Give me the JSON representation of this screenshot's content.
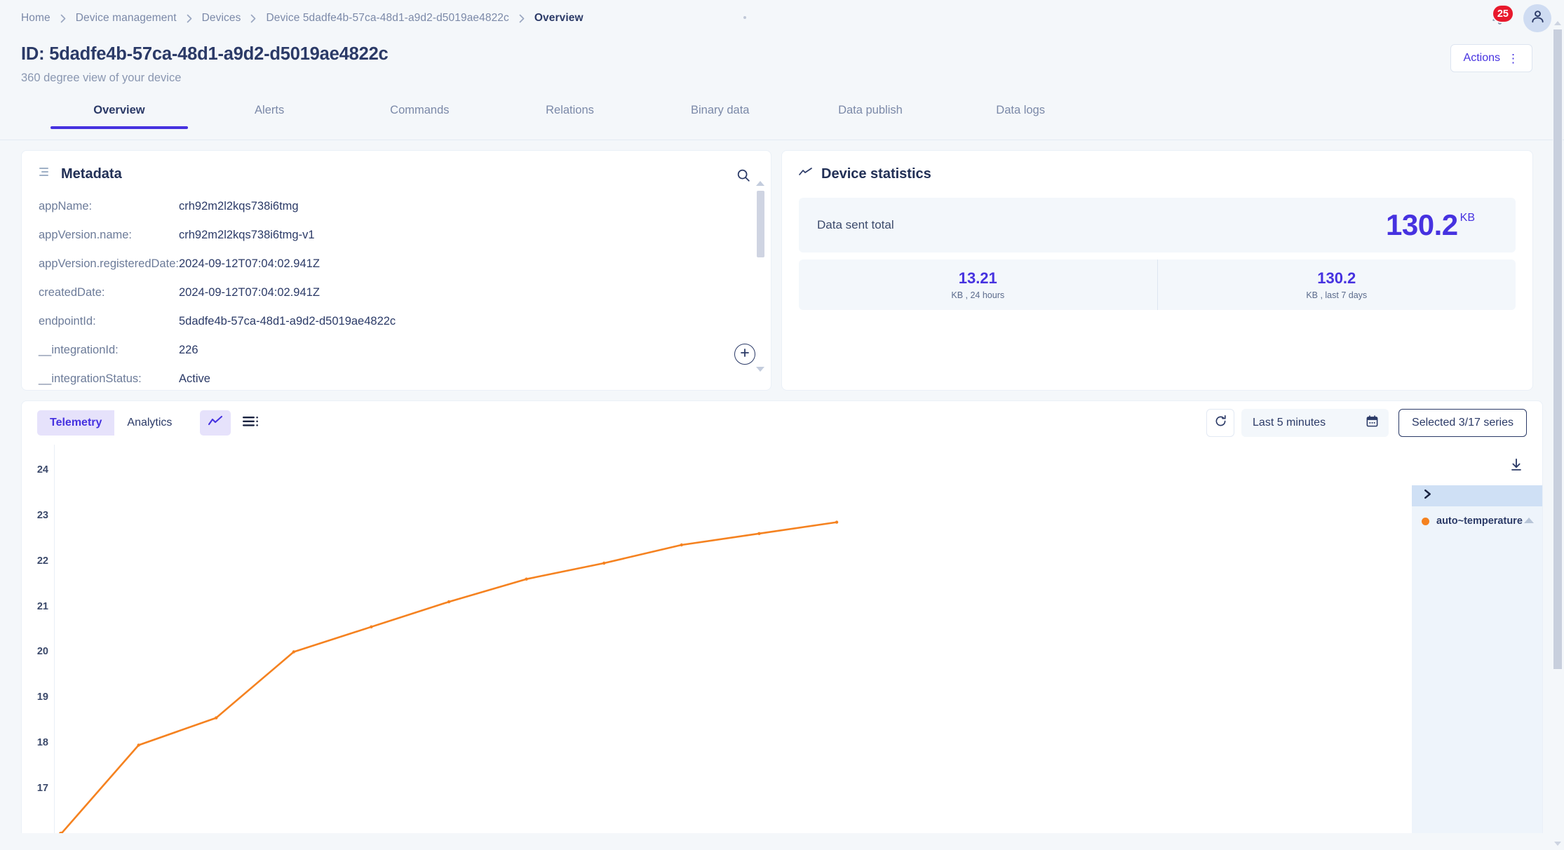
{
  "breadcrumb": {
    "items": [
      {
        "label": "Home",
        "active": false
      },
      {
        "label": "Device management",
        "active": false
      },
      {
        "label": "Devices",
        "active": false
      },
      {
        "label": "Device 5dadfe4b-57ca-48d1-a9d2-d5019ae4822c",
        "active": false
      },
      {
        "label": "Overview",
        "active": true
      }
    ]
  },
  "topbar": {
    "notification_count": "25",
    "bell_icon": "bell-alert-icon",
    "avatar_icon": "user-avatar-icon"
  },
  "header": {
    "title": "ID: 5dadfe4b-57ca-48d1-a9d2-d5019ae4822c",
    "subtitle": "360 degree view of your device",
    "actions_label": "Actions",
    "actions_kebab": "⋮"
  },
  "tabs": [
    {
      "label": "Overview",
      "active": true
    },
    {
      "label": "Alerts",
      "active": false
    },
    {
      "label": "Commands",
      "active": false
    },
    {
      "label": "Relations",
      "active": false
    },
    {
      "label": "Binary data",
      "active": false
    },
    {
      "label": "Data publish",
      "active": false
    },
    {
      "label": "Data logs",
      "active": false
    }
  ],
  "metadata": {
    "title": "Metadata",
    "icon": "list-lines-icon",
    "search_icon": "search-icon",
    "add_icon": "plus-circle-icon",
    "rows": [
      {
        "key": "appName:",
        "value": "crh92m2l2kqs738i6tmg"
      },
      {
        "key": "appVersion.name:",
        "value": "crh92m2l2kqs738i6tmg-v1"
      },
      {
        "key": "appVersion.registeredDate:",
        "value": "2024-09-12T07:04:02.941Z"
      },
      {
        "key": "createdDate:",
        "value": "2024-09-12T07:04:02.941Z"
      },
      {
        "key": "endpointId:",
        "value": "5dadfe4b-57ca-48d1-a9d2-d5019ae4822c"
      },
      {
        "key": "__integrationId:",
        "value": "226"
      },
      {
        "key": "__integrationStatus:",
        "value": "Active"
      }
    ]
  },
  "statistics": {
    "title": "Device statistics",
    "icon": "trend-line-icon",
    "total": {
      "label": "Data sent total",
      "value": "130.2",
      "unit": "KB"
    },
    "cells": [
      {
        "value": "13.21",
        "label": "KB , 24 hours"
      },
      {
        "value": "130.2",
        "label": "KB , last 7 days"
      }
    ]
  },
  "telemetry": {
    "segments": [
      {
        "label": "Telemetry",
        "active": true
      },
      {
        "label": "Analytics",
        "active": false
      }
    ],
    "view_chart_icon": "line-chart-icon",
    "view_table_icon": "list-view-icon",
    "refresh_icon": "refresh-icon",
    "time_range": "Last 5 minutes",
    "calendar_icon": "calendar-icon",
    "series_selector": "Selected 3/17 series",
    "download_icon": "download-icon",
    "legend": {
      "collapse_icon": "chevron-right-icon",
      "items": [
        {
          "label": "auto~temperature",
          "color": "#f58220"
        }
      ]
    }
  },
  "colors": {
    "accent_purple": "#4632e0",
    "series_orange": "#f58220",
    "badge_red": "#e8192c",
    "text_dark": "#2b3a67",
    "text_muted": "#7b89a8",
    "page_bg": "#f4f7fa"
  },
  "chart_data": {
    "type": "line",
    "title": "",
    "xlabel": "",
    "ylabel": "",
    "grid": false,
    "legend_position": "right",
    "ylim": [
      16.0,
      24.4
    ],
    "yticks": [
      24,
      23,
      22,
      21,
      20,
      19,
      18,
      17
    ],
    "series": [
      {
        "name": "auto~temperature",
        "color": "#f58220",
        "x": [
          0,
          1,
          2,
          3,
          4,
          5,
          6,
          7,
          8,
          9,
          10
        ],
        "values": [
          16.0,
          17.95,
          18.55,
          20.0,
          20.55,
          21.1,
          21.6,
          21.95,
          22.35,
          22.6,
          22.85
        ]
      }
    ]
  }
}
